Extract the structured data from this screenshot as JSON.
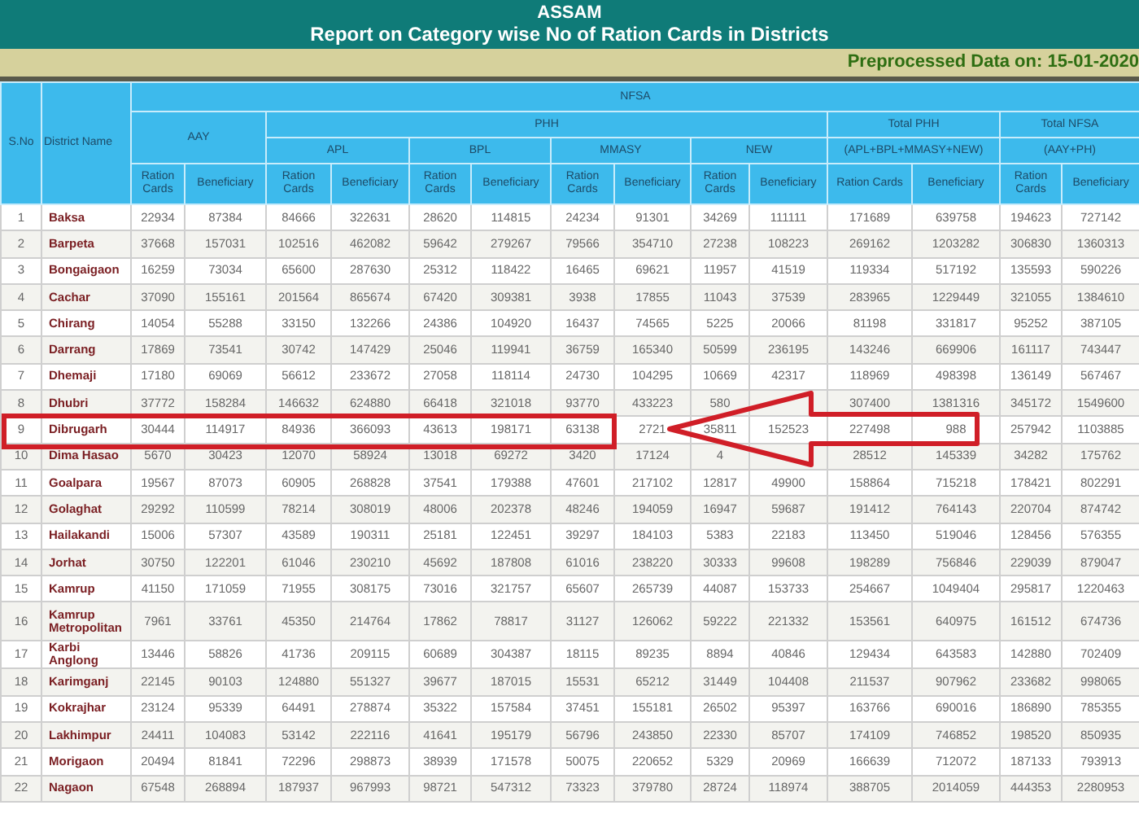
{
  "title": "ASSAM",
  "subtitle": "Report on Category wise No of Ration Cards in Districts",
  "date_note": "Preprocessed Data on: 15-01-2020",
  "header": {
    "sno": "S.No",
    "district": "District Name",
    "group": "NFSA",
    "aay": "AAY",
    "phh": "PHH",
    "total_phh": "Total PHH",
    "total_nfsa": "Total NFSA",
    "phh_subgroups": [
      "APL",
      "BPL",
      "MMASY",
      "NEW"
    ],
    "total_phh_formula": "(APL+BPL+MMASY+NEW)",
    "total_nfsa_formula": "(AAY+PH)",
    "sub_columns": [
      "Ration Cards",
      "Beneficiary",
      "Ration Cards",
      "Beneficiary",
      "Ration Cards",
      "Beneficiary",
      "Ration Cards",
      "Beneficiary",
      "Ration Cards",
      "Beneficiary",
      "Ration Cards",
      "Beneficiary",
      "Ration Cards",
      "Beneficiary"
    ]
  },
  "rows": [
    {
      "sno": "1",
      "district": "Baksa",
      "highlighted": false,
      "aay_rc": "22934",
      "aay_ben": "87384",
      "apl_rc": "84666",
      "apl_ben": "322631",
      "bpl_rc": "28620",
      "bpl_ben": "114815",
      "mmasy_rc": "24234",
      "mmasy_ben": "91301",
      "new_rc": "34269",
      "new_ben": "111111",
      "tphh_rc": "171689",
      "tphh_ben": "639758",
      "tnfsa_rc": "194623",
      "tnfsa_ben": "727142"
    },
    {
      "sno": "2",
      "district": "Barpeta",
      "highlighted": false,
      "aay_rc": "37668",
      "aay_ben": "157031",
      "apl_rc": "102516",
      "apl_ben": "462082",
      "bpl_rc": "59642",
      "bpl_ben": "279267",
      "mmasy_rc": "79566",
      "mmasy_ben": "354710",
      "new_rc": "27238",
      "new_ben": "108223",
      "tphh_rc": "269162",
      "tphh_ben": "1203282",
      "tnfsa_rc": "306830",
      "tnfsa_ben": "1360313"
    },
    {
      "sno": "3",
      "district": "Bongaigaon",
      "highlighted": false,
      "aay_rc": "16259",
      "aay_ben": "73034",
      "apl_rc": "65600",
      "apl_ben": "287630",
      "bpl_rc": "25312",
      "bpl_ben": "118422",
      "mmasy_rc": "16465",
      "mmasy_ben": "69621",
      "new_rc": "11957",
      "new_ben": "41519",
      "tphh_rc": "119334",
      "tphh_ben": "517192",
      "tnfsa_rc": "135593",
      "tnfsa_ben": "590226"
    },
    {
      "sno": "4",
      "district": "Cachar",
      "highlighted": false,
      "aay_rc": "37090",
      "aay_ben": "155161",
      "apl_rc": "201564",
      "apl_ben": "865674",
      "bpl_rc": "67420",
      "bpl_ben": "309381",
      "mmasy_rc": "3938",
      "mmasy_ben": "17855",
      "new_rc": "11043",
      "new_ben": "37539",
      "tphh_rc": "283965",
      "tphh_ben": "1229449",
      "tnfsa_rc": "321055",
      "tnfsa_ben": "1384610"
    },
    {
      "sno": "5",
      "district": "Chirang",
      "highlighted": false,
      "aay_rc": "14054",
      "aay_ben": "55288",
      "apl_rc": "33150",
      "apl_ben": "132266",
      "bpl_rc": "24386",
      "bpl_ben": "104920",
      "mmasy_rc": "16437",
      "mmasy_ben": "74565",
      "new_rc": "5225",
      "new_ben": "20066",
      "tphh_rc": "81198",
      "tphh_ben": "331817",
      "tnfsa_rc": "95252",
      "tnfsa_ben": "387105"
    },
    {
      "sno": "6",
      "district": "Darrang",
      "highlighted": false,
      "aay_rc": "17869",
      "aay_ben": "73541",
      "apl_rc": "30742",
      "apl_ben": "147429",
      "bpl_rc": "25046",
      "bpl_ben": "119941",
      "mmasy_rc": "36759",
      "mmasy_ben": "165340",
      "new_rc": "50599",
      "new_ben": "236195",
      "tphh_rc": "143246",
      "tphh_ben": "669906",
      "tnfsa_rc": "161117",
      "tnfsa_ben": "743447"
    },
    {
      "sno": "7",
      "district": "Dhemaji",
      "highlighted": false,
      "aay_rc": "17180",
      "aay_ben": "69069",
      "apl_rc": "56612",
      "apl_ben": "233672",
      "bpl_rc": "27058",
      "bpl_ben": "118114",
      "mmasy_rc": "24730",
      "mmasy_ben": "104295",
      "new_rc": "10669",
      "new_ben": "42317",
      "tphh_rc": "118969",
      "tphh_ben": "498398",
      "tnfsa_rc": "136149",
      "tnfsa_ben": "567467"
    },
    {
      "sno": "8",
      "district": "Dhubri",
      "highlighted": false,
      "aay_rc": "37772",
      "aay_ben": "158284",
      "apl_rc": "146632",
      "apl_ben": "624880",
      "bpl_rc": "66418",
      "bpl_ben": "321018",
      "mmasy_rc": "93770",
      "mmasy_ben": "433223",
      "new_rc": "580",
      "tphh_rc": "307400",
      "tphh_ben": "1381316",
      "tnfsa_rc": "345172",
      "tnfsa_ben": "1549600"
    },
    {
      "sno": "9",
      "district": "Dibrugarh",
      "highlighted": true,
      "aay_rc": "30444",
      "aay_ben": "114917",
      "apl_rc": "84936",
      "apl_ben": "366093",
      "bpl_rc": "43613",
      "bpl_ben": "198171",
      "mmasy_rc": "63138",
      "mmasy_ben": "2721",
      "new_rc": "35811",
      "new_ben": "152523",
      "tphh_rc": "227498",
      "tphh_ben": "988",
      "tnfsa_rc": "257942",
      "tnfsa_ben": "1103885"
    },
    {
      "sno": "10",
      "district": "Dima Hasao",
      "highlighted": false,
      "aay_rc": "5670",
      "aay_ben": "30423",
      "apl_rc": "12070",
      "apl_ben": "58924",
      "bpl_rc": "13018",
      "bpl_ben": "69272",
      "mmasy_rc": "3420",
      "mmasy_ben": "17124",
      "new_rc": "4",
      "tphh_rc": "28512",
      "tphh_ben": "145339",
      "tnfsa_rc": "34282",
      "tnfsa_ben": "175762"
    },
    {
      "sno": "11",
      "district": "Goalpara",
      "highlighted": false,
      "aay_rc": "19567",
      "aay_ben": "87073",
      "apl_rc": "60905",
      "apl_ben": "268828",
      "bpl_rc": "37541",
      "bpl_ben": "179388",
      "mmasy_rc": "47601",
      "mmasy_ben": "217102",
      "new_rc": "12817",
      "new_ben": "49900",
      "tphh_rc": "158864",
      "tphh_ben": "715218",
      "tnfsa_rc": "178421",
      "tnfsa_ben": "802291"
    },
    {
      "sno": "12",
      "district": "Golaghat",
      "highlighted": false,
      "aay_rc": "29292",
      "aay_ben": "110599",
      "apl_rc": "78214",
      "apl_ben": "308019",
      "bpl_rc": "48006",
      "bpl_ben": "202378",
      "mmasy_rc": "48246",
      "mmasy_ben": "194059",
      "new_rc": "16947",
      "new_ben": "59687",
      "tphh_rc": "191412",
      "tphh_ben": "764143",
      "tnfsa_rc": "220704",
      "tnfsa_ben": "874742"
    },
    {
      "sno": "13",
      "district": "Hailakandi",
      "highlighted": false,
      "aay_rc": "15006",
      "aay_ben": "57307",
      "apl_rc": "43589",
      "apl_ben": "190311",
      "bpl_rc": "25181",
      "bpl_ben": "122451",
      "mmasy_rc": "39297",
      "mmasy_ben": "184103",
      "new_rc": "5383",
      "new_ben": "22183",
      "tphh_rc": "113450",
      "tphh_ben": "519046",
      "tnfsa_rc": "128456",
      "tnfsa_ben": "576355"
    },
    {
      "sno": "14",
      "district": "Jorhat",
      "highlighted": false,
      "aay_rc": "30750",
      "aay_ben": "122201",
      "apl_rc": "61046",
      "apl_ben": "230210",
      "bpl_rc": "45692",
      "bpl_ben": "187808",
      "mmasy_rc": "61016",
      "mmasy_ben": "238220",
      "new_rc": "30333",
      "new_ben": "99608",
      "tphh_rc": "198289",
      "tphh_ben": "756846",
      "tnfsa_rc": "229039",
      "tnfsa_ben": "879047"
    },
    {
      "sno": "15",
      "district": "Kamrup",
      "highlighted": false,
      "aay_rc": "41150",
      "aay_ben": "171059",
      "apl_rc": "71955",
      "apl_ben": "308175",
      "bpl_rc": "73016",
      "bpl_ben": "321757",
      "mmasy_rc": "65607",
      "mmasy_ben": "265739",
      "new_rc": "44087",
      "new_ben": "153733",
      "tphh_rc": "254667",
      "tphh_ben": "1049404",
      "tnfsa_rc": "295817",
      "tnfsa_ben": "1220463"
    },
    {
      "sno": "16",
      "district": "Kamrup Metropolitan",
      "highlighted": false,
      "aay_rc": "7961",
      "aay_ben": "33761",
      "apl_rc": "45350",
      "apl_ben": "214764",
      "bpl_rc": "17862",
      "bpl_ben": "78817",
      "mmasy_rc": "31127",
      "mmasy_ben": "126062",
      "new_rc": "59222",
      "new_ben": "221332",
      "tphh_rc": "153561",
      "tphh_ben": "640975",
      "tnfsa_rc": "161512",
      "tnfsa_ben": "674736"
    },
    {
      "sno": "17",
      "district": "Karbi Anglong",
      "highlighted": false,
      "aay_rc": "13446",
      "aay_ben": "58826",
      "apl_rc": "41736",
      "apl_ben": "209115",
      "bpl_rc": "60689",
      "bpl_ben": "304387",
      "mmasy_rc": "18115",
      "mmasy_ben": "89235",
      "new_rc": "8894",
      "new_ben": "40846",
      "tphh_rc": "129434",
      "tphh_ben": "643583",
      "tnfsa_rc": "142880",
      "tnfsa_ben": "702409"
    },
    {
      "sno": "18",
      "district": "Karimganj",
      "highlighted": false,
      "aay_rc": "22145",
      "aay_ben": "90103",
      "apl_rc": "124880",
      "apl_ben": "551327",
      "bpl_rc": "39677",
      "bpl_ben": "187015",
      "mmasy_rc": "15531",
      "mmasy_ben": "65212",
      "new_rc": "31449",
      "new_ben": "104408",
      "tphh_rc": "211537",
      "tphh_ben": "907962",
      "tnfsa_rc": "233682",
      "tnfsa_ben": "998065"
    },
    {
      "sno": "19",
      "district": "Kokrajhar",
      "highlighted": false,
      "aay_rc": "23124",
      "aay_ben": "95339",
      "apl_rc": "64491",
      "apl_ben": "278874",
      "bpl_rc": "35322",
      "bpl_ben": "157584",
      "mmasy_rc": "37451",
      "mmasy_ben": "155181",
      "new_rc": "26502",
      "new_ben": "95397",
      "tphh_rc": "163766",
      "tphh_ben": "690016",
      "tnfsa_rc": "186890",
      "tnfsa_ben": "785355"
    },
    {
      "sno": "20",
      "district": "Lakhimpur",
      "highlighted": false,
      "aay_rc": "24411",
      "aay_ben": "104083",
      "apl_rc": "53142",
      "apl_ben": "222116",
      "bpl_rc": "41641",
      "bpl_ben": "195179",
      "mmasy_rc": "56796",
      "mmasy_ben": "243850",
      "new_rc": "22330",
      "new_ben": "85707",
      "tphh_rc": "174109",
      "tphh_ben": "746852",
      "tnfsa_rc": "198520",
      "tnfsa_ben": "850935"
    },
    {
      "sno": "21",
      "district": "Morigaon",
      "highlighted": false,
      "aay_rc": "20494",
      "aay_ben": "81841",
      "apl_rc": "72296",
      "apl_ben": "298873",
      "bpl_rc": "38939",
      "bpl_ben": "171578",
      "mmasy_rc": "50075",
      "mmasy_ben": "220652",
      "new_rc": "5329",
      "new_ben": "20969",
      "tphh_rc": "166639",
      "tphh_ben": "712072",
      "tnfsa_rc": "187133",
      "tnfsa_ben": "793913"
    },
    {
      "sno": "22",
      "district": "Nagaon",
      "highlighted": false,
      "aay_rc": "67548",
      "aay_ben": "268894",
      "apl_rc": "187937",
      "apl_ben": "967993",
      "bpl_rc": "98721",
      "bpl_ben": "547312",
      "mmasy_rc": "73323",
      "mmasy_ben": "379780",
      "new_rc": "28724",
      "new_ben": "118974",
      "tphh_rc": "388705",
      "tphh_ben": "2014059",
      "tnfsa_rc": "444353",
      "tnfsa_ben": "2280953"
    }
  ]
}
